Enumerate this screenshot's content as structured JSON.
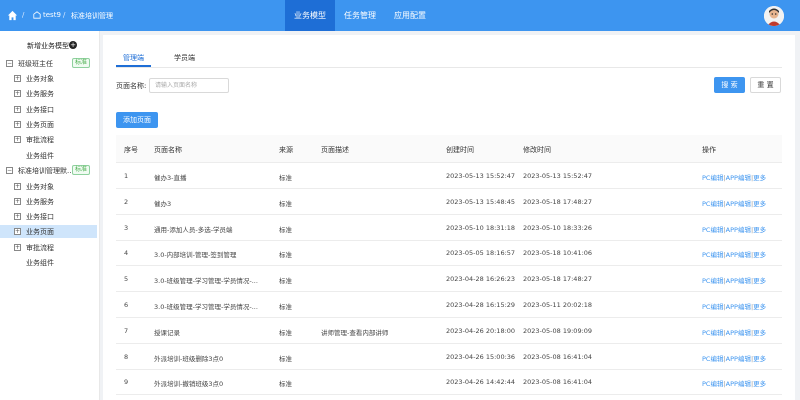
{
  "header": {
    "breadcrumb": [
      "test9",
      "标准培训管理"
    ],
    "nav": [
      {
        "label": "业务模型",
        "active": true
      },
      {
        "label": "任务管理",
        "active": false
      },
      {
        "label": "应用配置",
        "active": false
      }
    ],
    "accent": "#3d95f0"
  },
  "sidebar": {
    "new_model": "新增业务模型",
    "badge": "标准",
    "tree": [
      {
        "label": "班级班主任",
        "level": 0,
        "box": "−",
        "badge": true
      },
      {
        "label": "业务对象",
        "level": 1,
        "box": "+"
      },
      {
        "label": "业务服务",
        "level": 1,
        "box": "+"
      },
      {
        "label": "业务接口",
        "level": 1,
        "box": "+"
      },
      {
        "label": "业务页面",
        "level": 1,
        "box": "+"
      },
      {
        "label": "审批流程",
        "level": 1,
        "box": "+"
      },
      {
        "label": "业务组件",
        "level": 1,
        "box": ""
      },
      {
        "label": "标准培训管理默...",
        "level": 0,
        "box": "−",
        "badge": true
      },
      {
        "label": "业务对象",
        "level": 1,
        "box": "+"
      },
      {
        "label": "业务服务",
        "level": 1,
        "box": "+"
      },
      {
        "label": "业务接口",
        "level": 1,
        "box": "+"
      },
      {
        "label": "业务页面",
        "level": 1,
        "box": "+",
        "selected": true
      },
      {
        "label": "审批流程",
        "level": 1,
        "box": "+"
      },
      {
        "label": "业务组件",
        "level": 1,
        "box": ""
      }
    ]
  },
  "main": {
    "tabs": [
      {
        "label": "管理端",
        "active": true
      },
      {
        "label": "学员端",
        "active": false
      }
    ],
    "search": {
      "label": "页面名称:",
      "placeholder": "请输入页面名称",
      "search_btn": "搜 索",
      "reset_btn": "重 置"
    },
    "add_btn": "添加页面",
    "table": {
      "columns": [
        "序号",
        "页面名称",
        "来源",
        "页面描述",
        "创建时间",
        "修改时间",
        "操作"
      ],
      "rows": [
        {
          "no": "1",
          "name": "催办3-直播",
          "src": "标准",
          "desc": "",
          "created": "2023-05-13 15:52:47",
          "modified": "2023-05-13 15:52:47"
        },
        {
          "no": "2",
          "name": "催办3",
          "src": "标准",
          "desc": "",
          "created": "2023-05-13 15:48:45",
          "modified": "2023-05-18 17:48:27"
        },
        {
          "no": "3",
          "name": "通用-添加人员-多选-学员端",
          "src": "标准",
          "desc": "",
          "created": "2023-05-10 18:31:18",
          "modified": "2023-05-10 18:33:26"
        },
        {
          "no": "4",
          "name": "3.0-内部培训-管理-签到管理",
          "src": "标准",
          "desc": "",
          "created": "2023-05-05 18:16:57",
          "modified": "2023-05-18 10:41:06"
        },
        {
          "no": "5",
          "name": "3.0-班级管理-学习管理-学员情况-...",
          "src": "标准",
          "desc": "",
          "created": "2023-04-28 16:26:23",
          "modified": "2023-05-18 17:48:27"
        },
        {
          "no": "6",
          "name": "3.0-班级管理-学习管理-学员情况-...",
          "src": "标准",
          "desc": "",
          "created": "2023-04-28 16:15:29",
          "modified": "2023-05-11 20:02:18"
        },
        {
          "no": "7",
          "name": "授课记录",
          "src": "标准",
          "desc": "讲师管理-查看内部讲师",
          "created": "2023-04-26 20:18:00",
          "modified": "2023-05-08 19:09:09"
        },
        {
          "no": "8",
          "name": "外派培训-班级删除3点0",
          "src": "标准",
          "desc": "",
          "created": "2023-04-26 15:00:36",
          "modified": "2023-05-08 16:41:04"
        },
        {
          "no": "9",
          "name": "外派培训-撤销班级3点0",
          "src": "标准",
          "desc": "",
          "created": "2023-04-26 14:42:44",
          "modified": "2023-05-08 16:41:04"
        }
      ],
      "actions": {
        "pc": "PC编辑",
        "app": "APP编辑",
        "more": "更多",
        "sep": "|"
      }
    }
  }
}
